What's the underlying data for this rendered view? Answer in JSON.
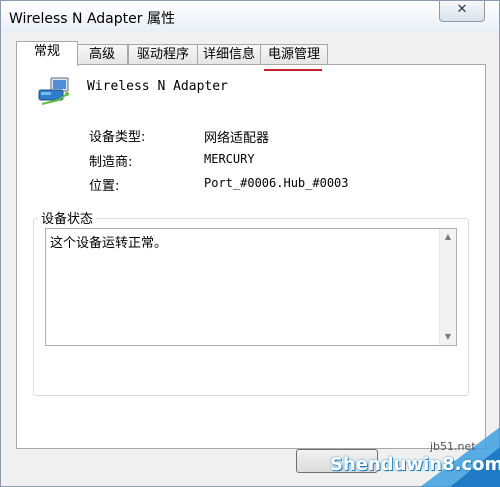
{
  "window": {
    "title": "Wireless N Adapter 属性",
    "close_symbol": "✕"
  },
  "tabs": [
    {
      "label": "常规",
      "active": true
    },
    {
      "label": "高级",
      "active": false
    },
    {
      "label": "驱动程序",
      "active": false
    },
    {
      "label": "详细信息",
      "active": false
    },
    {
      "label": "电源管理",
      "active": false
    }
  ],
  "device": {
    "icon": "network-adapter-icon",
    "name": "Wireless N Adapter"
  },
  "properties": {
    "type_label": "设备类型:",
    "type_value": "网络适配器",
    "manufacturer_label": "制造商:",
    "manufacturer_value": "MERCURY",
    "location_label": "位置:",
    "location_value": "Port_#0006.Hub_#0003"
  },
  "status": {
    "group_title": "设备状态",
    "text": "这个设备运转正常。"
  },
  "watermark": {
    "site": "Shenduwin8.com",
    "jb": "jb51.net"
  },
  "colors": {
    "highlight_underline": "#c8202a",
    "watermark_blue": "#2a8ec9"
  }
}
